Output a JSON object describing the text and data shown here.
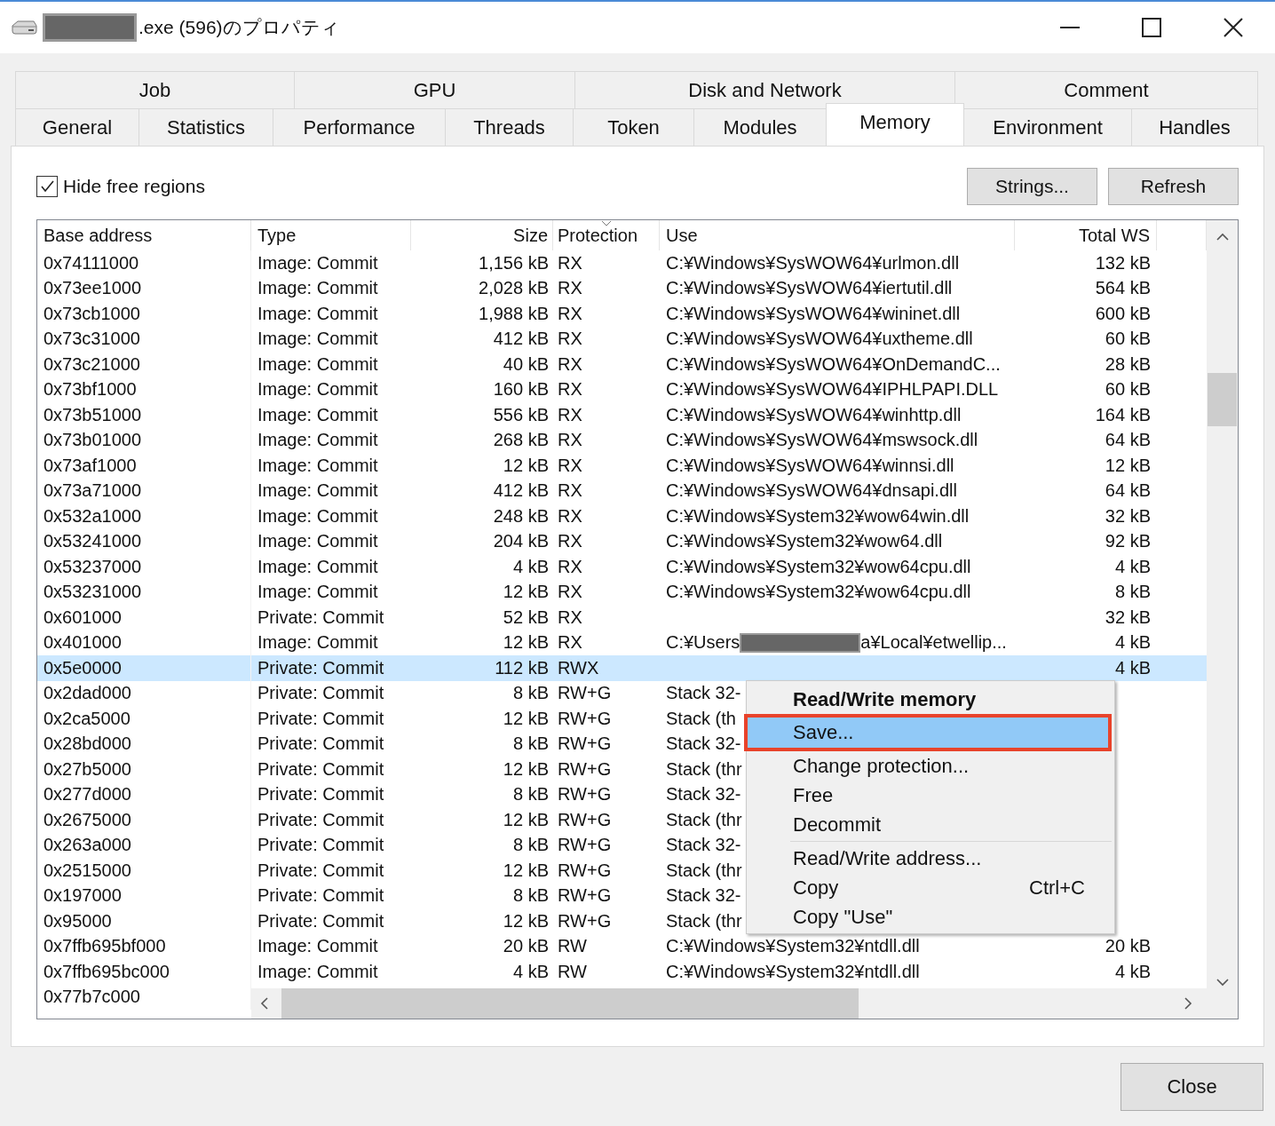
{
  "window": {
    "title": ".exe (596)のプロパティ",
    "title_redacted": true
  },
  "tabs_top": [
    {
      "label": "Job",
      "selected": false
    },
    {
      "label": "GPU",
      "selected": false
    },
    {
      "label": "Disk and Network",
      "selected": false
    },
    {
      "label": "Comment",
      "selected": false
    }
  ],
  "tabs": [
    {
      "label": "General",
      "selected": false
    },
    {
      "label": "Statistics",
      "selected": false
    },
    {
      "label": "Performance",
      "selected": false
    },
    {
      "label": "Threads",
      "selected": false
    },
    {
      "label": "Token",
      "selected": false
    },
    {
      "label": "Modules",
      "selected": false
    },
    {
      "label": "Memory",
      "selected": true
    },
    {
      "label": "Environment",
      "selected": false
    },
    {
      "label": "Handles",
      "selected": false
    }
  ],
  "hide_free_regions": {
    "label": "Hide free regions",
    "checked": true
  },
  "buttons": [
    "Strings...",
    "Refresh"
  ],
  "table": {
    "columns": [
      {
        "label": "Base address",
        "sorted": false
      },
      {
        "label": "Type",
        "sorted": false
      },
      {
        "label": "Size",
        "sorted": false
      },
      {
        "label": "Protection",
        "sorted": true
      },
      {
        "label": "Use",
        "sorted": false
      },
      {
        "label": "Total WS",
        "sorted": false
      }
    ],
    "rows": [
      {
        "address": "0x74111000",
        "type": "Image: Commit",
        "size": "1,156 kB",
        "protection": "RX",
        "use": "C:¥Windows¥SysWOW64¥urlmon.dll",
        "total_ws": "132 kB",
        "selected": false
      },
      {
        "address": "0x73ee1000",
        "type": "Image: Commit",
        "size": "2,028 kB",
        "protection": "RX",
        "use": "C:¥Windows¥SysWOW64¥iertutil.dll",
        "total_ws": "564 kB",
        "selected": false
      },
      {
        "address": "0x73cb1000",
        "type": "Image: Commit",
        "size": "1,988 kB",
        "protection": "RX",
        "use": "C:¥Windows¥SysWOW64¥wininet.dll",
        "total_ws": "600 kB",
        "selected": false
      },
      {
        "address": "0x73c31000",
        "type": "Image: Commit",
        "size": "412 kB",
        "protection": "RX",
        "use": "C:¥Windows¥SysWOW64¥uxtheme.dll",
        "total_ws": "60 kB",
        "selected": false
      },
      {
        "address": "0x73c21000",
        "type": "Image: Commit",
        "size": "40 kB",
        "protection": "RX",
        "use": "C:¥Windows¥SysWOW64¥OnDemandC...",
        "total_ws": "28 kB",
        "selected": false
      },
      {
        "address": "0x73bf1000",
        "type": "Image: Commit",
        "size": "160 kB",
        "protection": "RX",
        "use": "C:¥Windows¥SysWOW64¥IPHLPAPI.DLL",
        "total_ws": "60 kB",
        "selected": false
      },
      {
        "address": "0x73b51000",
        "type": "Image: Commit",
        "size": "556 kB",
        "protection": "RX",
        "use": "C:¥Windows¥SysWOW64¥winhttp.dll",
        "total_ws": "164 kB",
        "selected": false
      },
      {
        "address": "0x73b01000",
        "type": "Image: Commit",
        "size": "268 kB",
        "protection": "RX",
        "use": "C:¥Windows¥SysWOW64¥mswsock.dll",
        "total_ws": "64 kB",
        "selected": false
      },
      {
        "address": "0x73af1000",
        "type": "Image: Commit",
        "size": "12 kB",
        "protection": "RX",
        "use": "C:¥Windows¥SysWOW64¥winnsi.dll",
        "total_ws": "12 kB",
        "selected": false
      },
      {
        "address": "0x73a71000",
        "type": "Image: Commit",
        "size": "412 kB",
        "protection": "RX",
        "use": "C:¥Windows¥SysWOW64¥dnsapi.dll",
        "total_ws": "64 kB",
        "selected": false
      },
      {
        "address": "0x532a1000",
        "type": "Image: Commit",
        "size": "248 kB",
        "protection": "RX",
        "use": "C:¥Windows¥System32¥wow64win.dll",
        "total_ws": "32 kB",
        "selected": false
      },
      {
        "address": "0x53241000",
        "type": "Image: Commit",
        "size": "204 kB",
        "protection": "RX",
        "use": "C:¥Windows¥System32¥wow64.dll",
        "total_ws": "92 kB",
        "selected": false
      },
      {
        "address": "0x53237000",
        "type": "Image: Commit",
        "size": "4 kB",
        "protection": "RX",
        "use": "C:¥Windows¥System32¥wow64cpu.dll",
        "total_ws": "4 kB",
        "selected": false
      },
      {
        "address": "0x53231000",
        "type": "Image: Commit",
        "size": "12 kB",
        "protection": "RX",
        "use": "C:¥Windows¥System32¥wow64cpu.dll",
        "total_ws": "8 kB",
        "selected": false
      },
      {
        "address": "0x601000",
        "type": "Private: Commit",
        "size": "52 kB",
        "protection": "RX",
        "total_ws": "32 kB",
        "selected": false
      },
      {
        "address": "0x401000",
        "type": "Image: Commit",
        "size": "12 kB",
        "protection": "RX",
        "use": "C:¥Users",
        "use_after_redaction": "a¥Local¥etwellip...",
        "total_ws": "4 kB",
        "selected": false
      },
      {
        "address": "0x5e0000",
        "type": "Private: Commit",
        "size": "112 kB",
        "protection": "RWX",
        "total_ws": "4 kB",
        "selected": true
      },
      {
        "address": "0x2dad000",
        "type": "Private: Commit",
        "size": "8 kB",
        "protection": "RW+G",
        "use": "Stack 32-",
        "selected": false
      },
      {
        "address": "0x2ca5000",
        "type": "Private: Commit",
        "size": "12 kB",
        "protection": "RW+G",
        "use": "Stack (th",
        "selected": false
      },
      {
        "address": "0x28bd000",
        "type": "Private: Commit",
        "size": "8 kB",
        "protection": "RW+G",
        "use": "Stack 32-",
        "selected": false
      },
      {
        "address": "0x27b5000",
        "type": "Private: Commit",
        "size": "12 kB",
        "protection": "RW+G",
        "use": "Stack (thr",
        "selected": false
      },
      {
        "address": "0x277d000",
        "type": "Private: Commit",
        "size": "8 kB",
        "protection": "RW+G",
        "use": "Stack 32-",
        "selected": false
      },
      {
        "address": "0x2675000",
        "type": "Private: Commit",
        "size": "12 kB",
        "protection": "RW+G",
        "use": "Stack (thr",
        "selected": false
      },
      {
        "address": "0x263a000",
        "type": "Private: Commit",
        "size": "8 kB",
        "protection": "RW+G",
        "use": "Stack 32-",
        "selected": false
      },
      {
        "address": "0x2515000",
        "type": "Private: Commit",
        "size": "12 kB",
        "protection": "RW+G",
        "use": "Stack (thr",
        "selected": false
      },
      {
        "address": "0x197000",
        "type": "Private: Commit",
        "size": "8 kB",
        "protection": "RW+G",
        "use": "Stack 32-",
        "selected": false
      },
      {
        "address": "0x95000",
        "type": "Private: Commit",
        "size": "12 kB",
        "protection": "RW+G",
        "use": "Stack (thr",
        "selected": false
      },
      {
        "address": "0x7ffb695bf000",
        "type": "Image: Commit",
        "size": "20 kB",
        "protection": "RW",
        "use": "C:¥Windows¥System32¥ntdll.dll",
        "total_ws": "20 kB",
        "selected": false
      },
      {
        "address": "0x7ffb695bc000",
        "type": "Image: Commit",
        "size": "4 kB",
        "protection": "RW",
        "use": "C:¥Windows¥System32¥ntdll.dll",
        "total_ws": "4 kB",
        "selected": false
      },
      {
        "address": "0x77b7c000",
        "selected": false
      }
    ]
  },
  "context_menu": {
    "items": [
      {
        "kind": "item",
        "label": "Read/Write memory",
        "bold": true,
        "highlighted": false,
        "outlined": false
      },
      {
        "kind": "item",
        "label": "Save...",
        "bold": false,
        "highlighted": true,
        "outlined": true
      },
      {
        "kind": "item",
        "label": "Change protection...",
        "bold": false,
        "highlighted": false,
        "outlined": false
      },
      {
        "kind": "item",
        "label": "Free",
        "bold": false,
        "highlighted": false,
        "outlined": false
      },
      {
        "kind": "item",
        "label": "Decommit",
        "bold": false,
        "highlighted": false,
        "outlined": false
      },
      {
        "kind": "separator"
      },
      {
        "kind": "item",
        "label": "Read/Write address...",
        "bold": false,
        "highlighted": false,
        "outlined": false
      },
      {
        "kind": "item",
        "label": "Copy",
        "shortcut": "Ctrl+C",
        "bold": false,
        "highlighted": false,
        "outlined": false
      },
      {
        "kind": "item",
        "label": "Copy \"Use\"",
        "bold": false,
        "highlighted": false,
        "outlined": false
      }
    ]
  },
  "close_button": "Close"
}
